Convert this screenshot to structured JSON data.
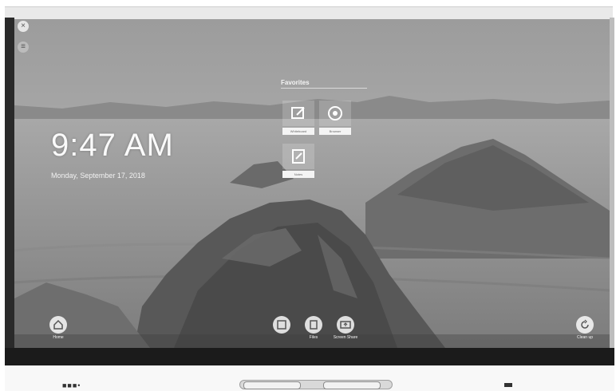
{
  "clock": {
    "time": "9:47 AM",
    "date": "Monday, September 17, 2018"
  },
  "favorites": {
    "title": "Favorites",
    "tiles": [
      {
        "label": "Whiteboard",
        "icon": "whiteboard-icon"
      },
      {
        "label": "Browser",
        "icon": "browser-icon"
      },
      {
        "label": "Notes",
        "icon": "notes-icon"
      }
    ]
  },
  "dock": {
    "left": {
      "label": "Home",
      "icon": "home-icon"
    },
    "center": [
      {
        "label": "",
        "icon": "whiteboard-icon"
      },
      {
        "label": "Files",
        "icon": "files-icon"
      },
      {
        "label": "Screen Share",
        "icon": "screen-share-icon"
      }
    ],
    "right": {
      "label": "Clean up",
      "icon": "refresh-icon"
    }
  },
  "colors": {
    "sky": "#a9a9a9",
    "rock": "#5e5e5e",
    "ground": "#8f8f8f",
    "bezel": "#1b1b1b",
    "text": "#fafafa"
  }
}
